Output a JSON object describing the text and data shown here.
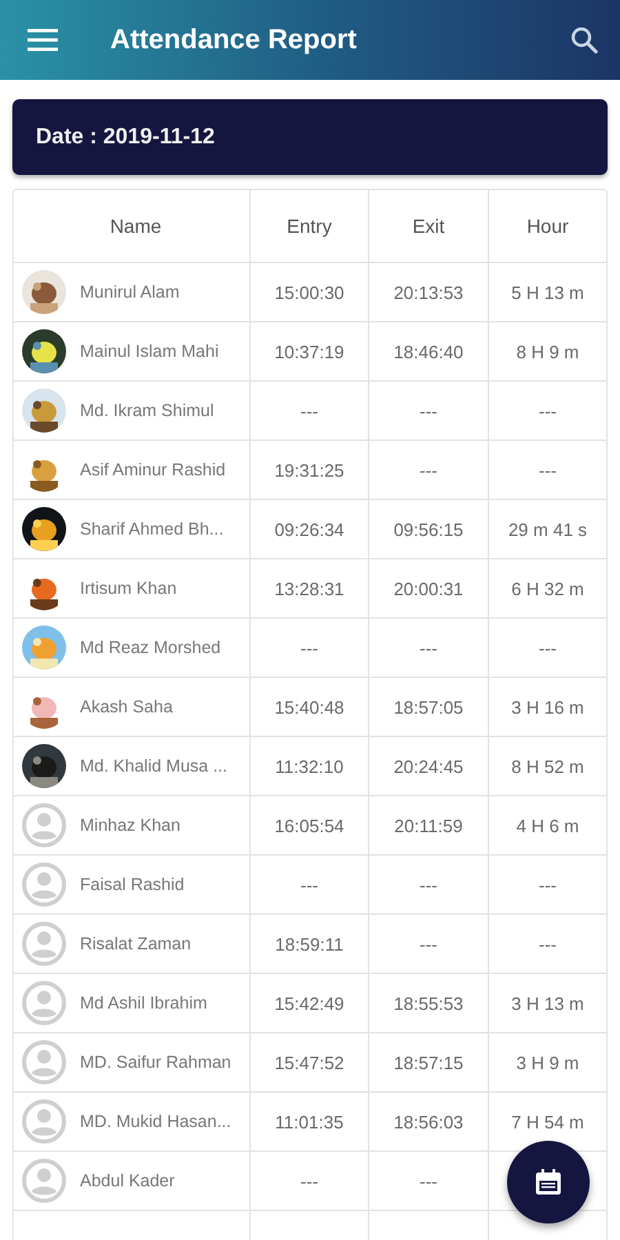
{
  "app_bar": {
    "title": "Attendance Report"
  },
  "date_banner": {
    "text": "Date : 2019-11-12"
  },
  "table": {
    "columns": [
      "Name",
      "Entry",
      "Exit",
      "Hour"
    ],
    "rows": [
      {
        "name": "Munirul Alam",
        "entry": "15:00:30",
        "exit": "20:13:53",
        "hour": "5 H 13 m"
      },
      {
        "name": "Mainul Islam Mahi",
        "entry": "10:37:19",
        "exit": "18:46:40",
        "hour": "8 H 9 m"
      },
      {
        "name": "Md. Ikram Shimul",
        "entry": "---",
        "exit": "---",
        "hour": "---"
      },
      {
        "name": "Asif Aminur Rashid",
        "entry": "19:31:25",
        "exit": "---",
        "hour": "---"
      },
      {
        "name": "Sharif Ahmed Bh...",
        "entry": "09:26:34",
        "exit": "09:56:15",
        "hour": "29 m 41 s"
      },
      {
        "name": "Irtisum Khan",
        "entry": "13:28:31",
        "exit": "20:00:31",
        "hour": "6 H 32 m"
      },
      {
        "name": "Md Reaz Morshed",
        "entry": "---",
        "exit": "---",
        "hour": "---"
      },
      {
        "name": "Akash Saha",
        "entry": "15:40:48",
        "exit": "18:57:05",
        "hour": "3 H 16 m"
      },
      {
        "name": "Md. Khalid Musa ...",
        "entry": "11:32:10",
        "exit": "20:24:45",
        "hour": "8 H 52 m"
      },
      {
        "avatar": {
          "kind": "placeholder"
        },
        "name": "Minhaz Khan",
        "entry": "16:05:54",
        "exit": "20:11:59",
        "hour": "4 H 6 m"
      },
      {
        "avatar": {
          "kind": "placeholder"
        },
        "name": "Faisal Rashid",
        "entry": "---",
        "exit": "---",
        "hour": "---"
      },
      {
        "avatar": {
          "kind": "placeholder"
        },
        "name": "Risalat Zaman",
        "entry": "18:59:11",
        "exit": "---",
        "hour": "---"
      },
      {
        "avatar": {
          "kind": "placeholder"
        },
        "name": "Md Ashil Ibrahim",
        "entry": "15:42:49",
        "exit": "18:55:53",
        "hour": "3 H 13 m"
      },
      {
        "avatar": {
          "kind": "placeholder"
        },
        "name": "MD. Saifur Rahman",
        "entry": "15:47:52",
        "exit": "18:57:15",
        "hour": "3 H 9 m"
      },
      {
        "avatar": {
          "kind": "placeholder"
        },
        "name": "MD. Mukid Hasan...",
        "entry": "11:01:35",
        "exit": "18:56:03",
        "hour": "7 H 54 m"
      },
      {
        "avatar": {
          "kind": "placeholder"
        },
        "name": "Abdul Kader",
        "entry": "---",
        "exit": "---"
      }
    ]
  }
}
